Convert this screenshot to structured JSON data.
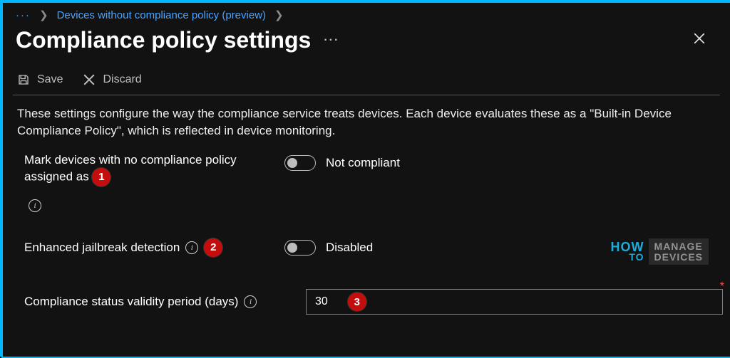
{
  "breadcrumb": {
    "ellipsis": "···",
    "link": "Devices without compliance policy (preview)"
  },
  "header": {
    "title": "Compliance policy settings",
    "more": "···"
  },
  "toolbar": {
    "save_label": "Save",
    "discard_label": "Discard"
  },
  "description": "These settings configure the way the compliance service treats devices. Each device evaluates these as a \"Built-in Device Compliance Policy\", which is reflected in device monitoring.",
  "settings": {
    "mark_devices": {
      "label_line1": "Mark devices with no compliance policy",
      "label_line2": "assigned as",
      "badge": "1",
      "toggle_state": "off",
      "toggle_text": "Not compliant"
    },
    "jailbreak": {
      "label": "Enhanced jailbreak detection",
      "badge": "2",
      "toggle_state": "off",
      "toggle_text": "Disabled"
    },
    "validity": {
      "label": "Compliance status validity period (days)",
      "badge": "3",
      "value": "30",
      "required_marker": "*"
    }
  },
  "watermark": {
    "left_top": "HOW",
    "left_bottom": "TO",
    "right_top": "MANAGE",
    "right_bottom": "DEVICES"
  }
}
